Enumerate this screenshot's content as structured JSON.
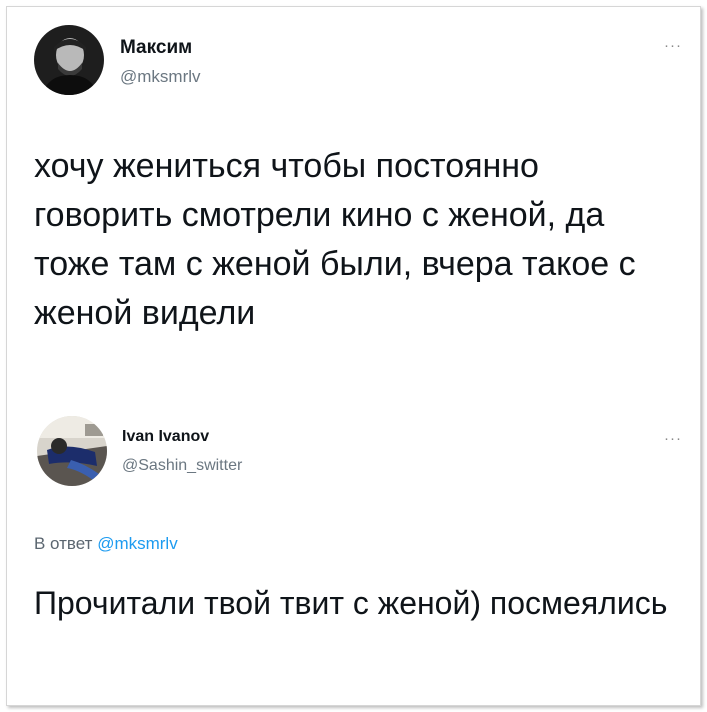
{
  "tweet_main": {
    "display_name": "Максим",
    "handle": "@mksmrlv",
    "text": "хочу жениться чтобы постоянно говорить смотрели кино с женой, да тоже там с женой были, вчера такое с женой видели",
    "avatar_icon": "person-avatar-dark"
  },
  "tweet_reply": {
    "display_name": "Ivan Ivanov",
    "handle": "@Sashin_switter",
    "reply_prefix": "В ответ",
    "reply_mention": "@mksmrlv",
    "text": "Прочитали твой твит с женой) посмеялись",
    "avatar_icon": "person-lying-avatar"
  },
  "more_icon_glyph": "···",
  "colors": {
    "mention": "#1d9bf0",
    "secondary_text": "#6b7781"
  }
}
